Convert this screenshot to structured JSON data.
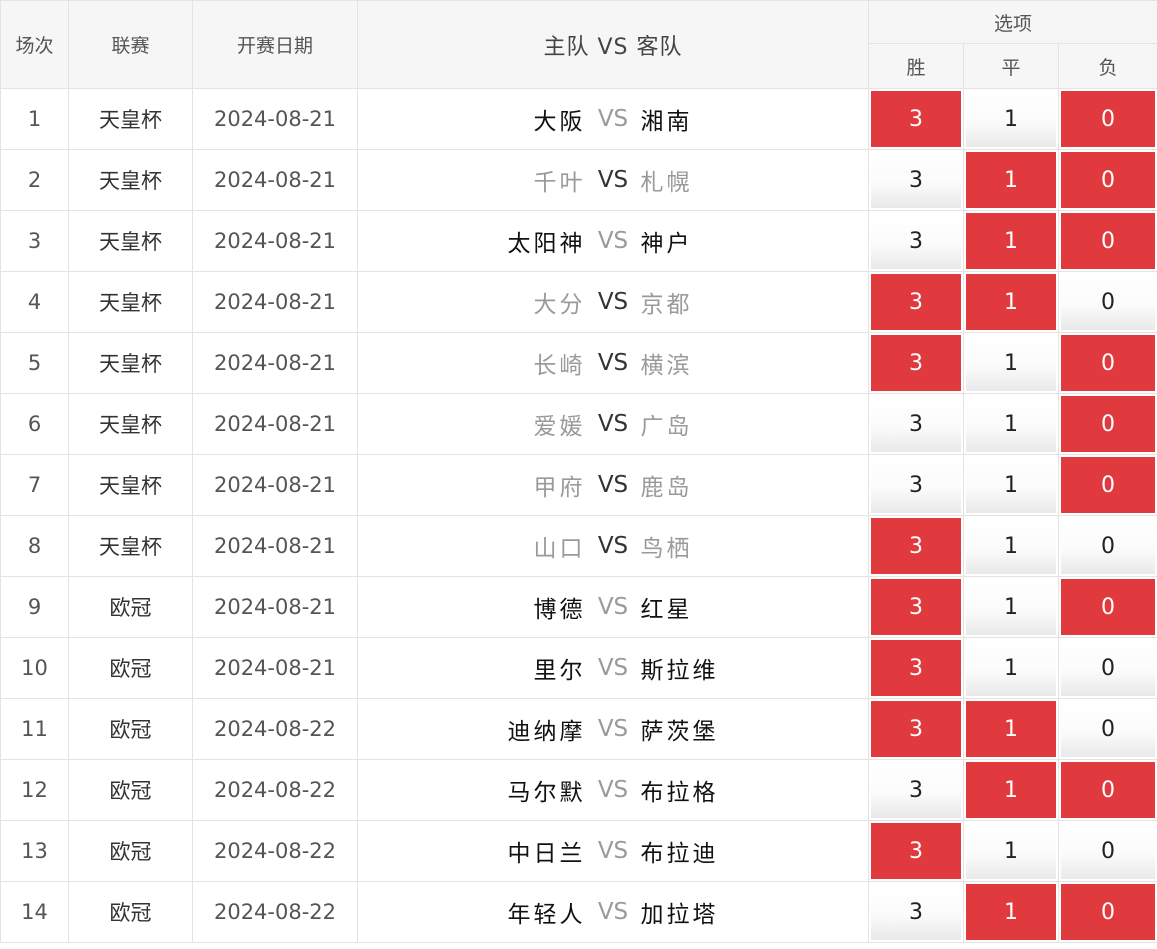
{
  "headers": {
    "index": "场次",
    "league": "联赛",
    "date": "开赛日期",
    "matchup": "主队 VS 客队",
    "options": "选项",
    "win": "胜",
    "draw": "平",
    "lose": "负"
  },
  "colors": {
    "selected": "#e0393e",
    "muted_text": "#9a9a9a",
    "header_bg": "#f6f6f6"
  },
  "rows": [
    {
      "idx": "1",
      "league": "天皇杯",
      "date": "2024-08-21",
      "home": "大阪",
      "vs": "VS",
      "away": "湘南",
      "style": "strong",
      "win": "3",
      "draw": "1",
      "lose": "0",
      "sel": [
        true,
        false,
        true
      ]
    },
    {
      "idx": "2",
      "league": "天皇杯",
      "date": "2024-08-21",
      "home": "千叶",
      "vs": "VS",
      "away": "札幌",
      "style": "muted",
      "win": "3",
      "draw": "1",
      "lose": "0",
      "sel": [
        false,
        true,
        true
      ]
    },
    {
      "idx": "3",
      "league": "天皇杯",
      "date": "2024-08-21",
      "home": "太阳神",
      "vs": "VS",
      "away": "神户",
      "style": "strong",
      "win": "3",
      "draw": "1",
      "lose": "0",
      "sel": [
        false,
        true,
        true
      ]
    },
    {
      "idx": "4",
      "league": "天皇杯",
      "date": "2024-08-21",
      "home": "大分",
      "vs": "VS",
      "away": "京都",
      "style": "muted",
      "win": "3",
      "draw": "1",
      "lose": "0",
      "sel": [
        true,
        true,
        false
      ]
    },
    {
      "idx": "5",
      "league": "天皇杯",
      "date": "2024-08-21",
      "home": "长崎",
      "vs": "VS",
      "away": "横滨",
      "style": "muted",
      "win": "3",
      "draw": "1",
      "lose": "0",
      "sel": [
        true,
        false,
        true
      ]
    },
    {
      "idx": "6",
      "league": "天皇杯",
      "date": "2024-08-21",
      "home": "爱媛",
      "vs": "VS",
      "away": "广岛",
      "style": "muted",
      "win": "3",
      "draw": "1",
      "lose": "0",
      "sel": [
        false,
        false,
        true
      ]
    },
    {
      "idx": "7",
      "league": "天皇杯",
      "date": "2024-08-21",
      "home": "甲府",
      "vs": "VS",
      "away": "鹿岛",
      "style": "muted",
      "win": "3",
      "draw": "1",
      "lose": "0",
      "sel": [
        false,
        false,
        true
      ]
    },
    {
      "idx": "8",
      "league": "天皇杯",
      "date": "2024-08-21",
      "home": "山口",
      "vs": "VS",
      "away": "鸟栖",
      "style": "muted",
      "win": "3",
      "draw": "1",
      "lose": "0",
      "sel": [
        true,
        false,
        false
      ]
    },
    {
      "idx": "9",
      "league": "欧冠",
      "date": "2024-08-21",
      "home": "博德",
      "vs": "VS",
      "away": "红星",
      "style": "strong",
      "win": "3",
      "draw": "1",
      "lose": "0",
      "sel": [
        true,
        false,
        true
      ]
    },
    {
      "idx": "10",
      "league": "欧冠",
      "date": "2024-08-21",
      "home": "里尔",
      "vs": "VS",
      "away": "斯拉维",
      "style": "strong",
      "win": "3",
      "draw": "1",
      "lose": "0",
      "sel": [
        true,
        false,
        false
      ]
    },
    {
      "idx": "11",
      "league": "欧冠",
      "date": "2024-08-22",
      "home": "迪纳摩",
      "vs": "VS",
      "away": "萨茨堡",
      "style": "strong",
      "win": "3",
      "draw": "1",
      "lose": "0",
      "sel": [
        true,
        true,
        false
      ]
    },
    {
      "idx": "12",
      "league": "欧冠",
      "date": "2024-08-22",
      "home": "马尔默",
      "vs": "VS",
      "away": "布拉格",
      "style": "strong",
      "win": "3",
      "draw": "1",
      "lose": "0",
      "sel": [
        false,
        true,
        true
      ]
    },
    {
      "idx": "13",
      "league": "欧冠",
      "date": "2024-08-22",
      "home": "中日兰",
      "vs": "VS",
      "away": "布拉迪",
      "style": "strong",
      "win": "3",
      "draw": "1",
      "lose": "0",
      "sel": [
        true,
        false,
        false
      ]
    },
    {
      "idx": "14",
      "league": "欧冠",
      "date": "2024-08-22",
      "home": "年轻人",
      "vs": "VS",
      "away": "加拉塔",
      "style": "strong",
      "win": "3",
      "draw": "1",
      "lose": "0",
      "sel": [
        false,
        true,
        true
      ]
    }
  ]
}
